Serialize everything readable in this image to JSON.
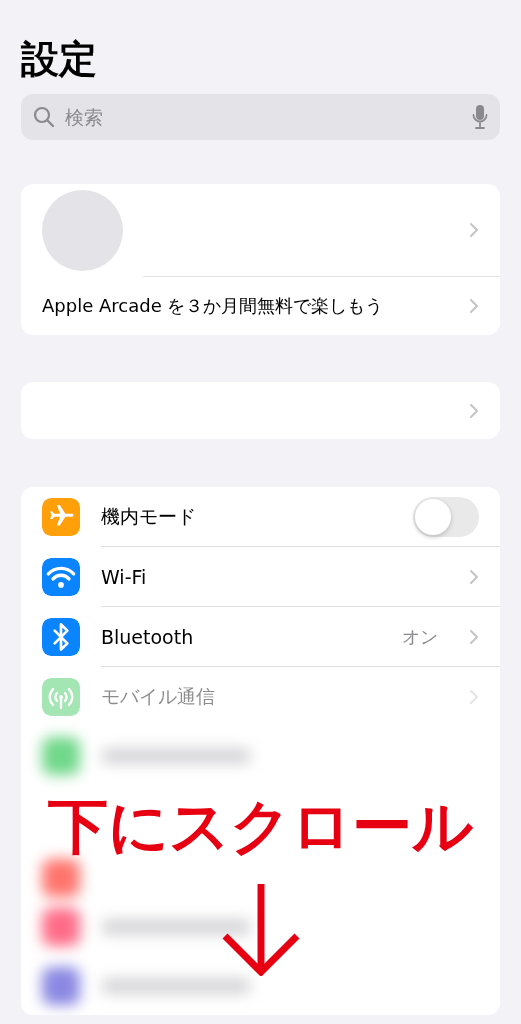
{
  "title": "設定",
  "search": {
    "placeholder": "検索"
  },
  "account_card": {
    "promo": "Apple Arcade を３か月間無料で楽しもう"
  },
  "settings": [
    {
      "kind": "toggle",
      "label": "機内モード",
      "on": false,
      "faded": false
    },
    {
      "kind": "link",
      "label": "Wi-Fi",
      "faded": false
    },
    {
      "kind": "link",
      "label": "Bluetooth",
      "value": "オン",
      "faded": false
    },
    {
      "kind": "link",
      "label": "モバイル通信",
      "faded": true
    }
  ],
  "overlay": {
    "caption": "下にスクロール"
  }
}
